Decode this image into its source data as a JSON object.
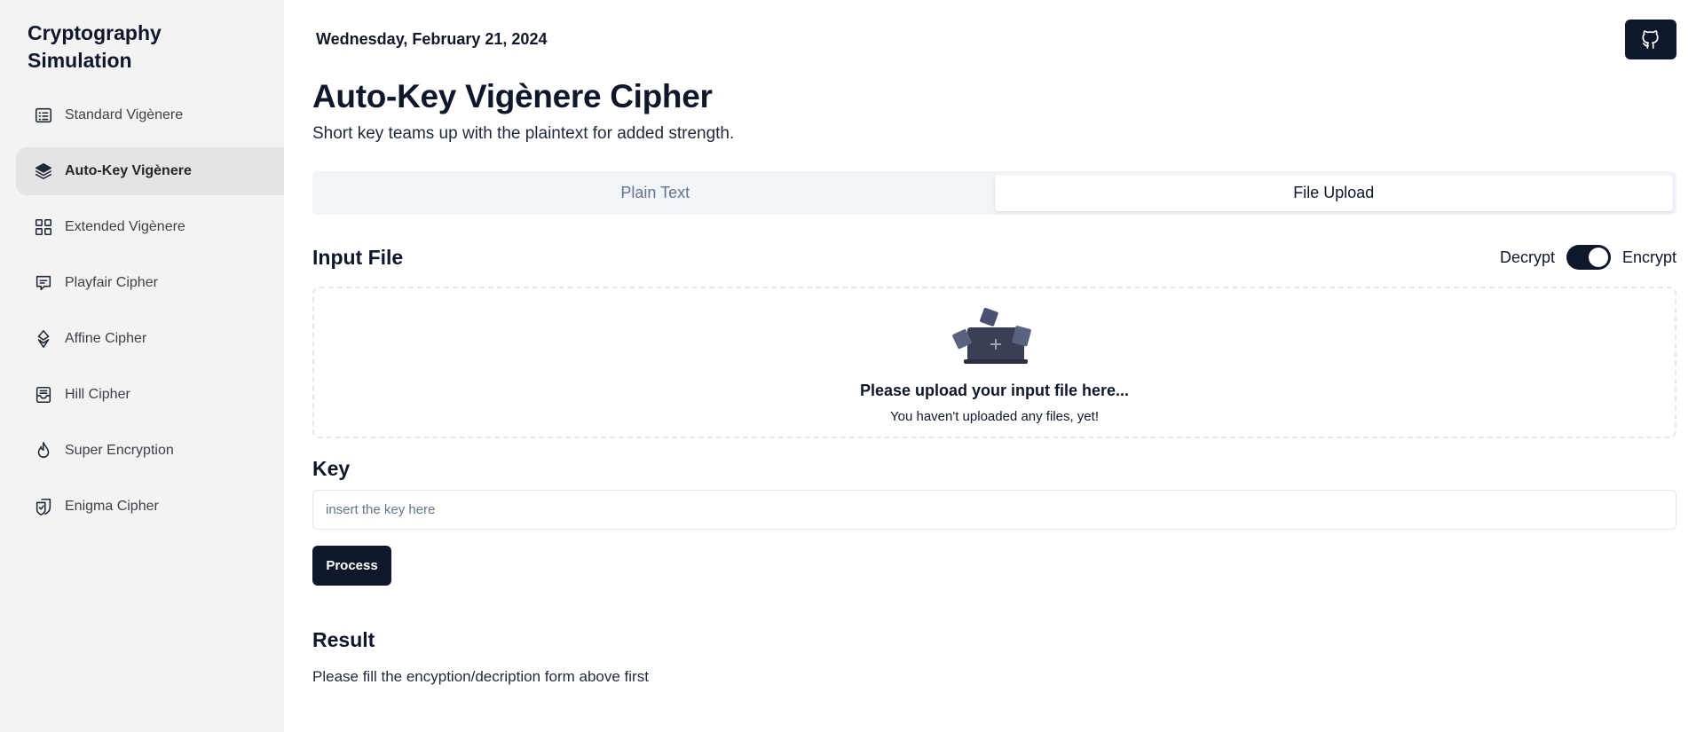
{
  "app": {
    "title": "Cryptography Simulation"
  },
  "sidebar": {
    "items": [
      {
        "label": "Standard Vigènere",
        "icon": "list-icon",
        "active": false
      },
      {
        "label": "Auto-Key Vigènere",
        "icon": "layers-icon",
        "active": true
      },
      {
        "label": "Extended Vigènere",
        "icon": "grid-icon",
        "active": false
      },
      {
        "label": "Playfair Cipher",
        "icon": "message-icon",
        "active": false
      },
      {
        "label": "Affine Cipher",
        "icon": "diamond-icon",
        "active": false
      },
      {
        "label": "Hill Cipher",
        "icon": "inbox-icon",
        "active": false
      },
      {
        "label": "Super Encryption",
        "icon": "flame-icon",
        "active": false
      },
      {
        "label": "Enigma Cipher",
        "icon": "shield-icon",
        "active": false
      }
    ]
  },
  "header": {
    "date": "Wednesday, February 21, 2024",
    "github_icon": "github-icon"
  },
  "page": {
    "title": "Auto-Key Vigènere Cipher",
    "subtitle": "Short key teams up with the plaintext for added strength."
  },
  "tabs": [
    {
      "label": "Plain Text",
      "active": false
    },
    {
      "label": "File Upload",
      "active": true
    }
  ],
  "form": {
    "input_file_label": "Input File",
    "mode": {
      "left_label": "Decrypt",
      "right_label": "Encrypt",
      "selected": "Encrypt"
    },
    "dropzone": {
      "title": "Please upload your input file here...",
      "subtitle": "You haven't uploaded any files, yet!"
    },
    "key_label": "Key",
    "key_value": "",
    "key_placeholder": "insert the key here",
    "process_label": "Process"
  },
  "result": {
    "label": "Result",
    "text": "Please fill the encyption/decription form above first"
  },
  "colors": {
    "primary": "#0f172a",
    "sidebar_bg": "#f3f3f4",
    "active_item_bg": "#e4e4e7",
    "tabs_bg": "#f1f5f9",
    "border": "#e2e8f0"
  }
}
